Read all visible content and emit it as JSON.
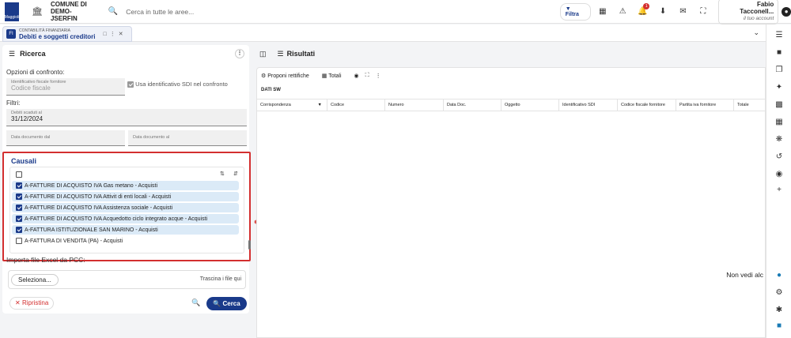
{
  "topbar": {
    "logo_text": "Maggioli",
    "comune_line1": "COMUNE DI",
    "comune_line2": "DEMO-JSERFIN",
    "search_placeholder": "Cerca in tutte le aree...",
    "filter_label": "Filtra",
    "notification_count": "1",
    "user_name": "Fabio Tacconell...",
    "user_role": "il tuo account",
    "icons": [
      "bank-icon",
      "grid-icon",
      "warning-icon",
      "bell-icon",
      "download-icon",
      "mail-icon",
      "fullscreen-icon",
      "account-icon"
    ]
  },
  "tab": {
    "subtitle": "CONTABILITÀ FINANZIARIA",
    "title": "Debiti e soggetti creditori"
  },
  "left": {
    "title": "Ricerca",
    "opzioni_label": "Opzioni di confronto:",
    "id_fiscale_label": "Identificativo fiscale fornitore",
    "id_fiscale_value": "Codice fiscale",
    "usa_sdi_label": "Usa identificativo SDI nel confronto",
    "filtri_label": "Filtri:",
    "debiti_label": "Debiti scaduti al",
    "debiti_value": "31/12/2024",
    "data_dal_label": "Data documento dal",
    "data_al_label": "Data documento al",
    "causali": {
      "title": "Causali",
      "items": [
        {
          "label": "A-FATTURE DI ACQUISTO IVA Gas metano - Acquisti",
          "checked": true
        },
        {
          "label": "A-FATTURE DI ACQUISTO IVA Attivit di enti locali - Acquisti",
          "checked": true
        },
        {
          "label": "A-FATTURE DI ACQUISTO IVA Assistenza sociale - Acquisti",
          "checked": true
        },
        {
          "label": "A-FATTURE DI ACQUISTO IVA Acquedotto ciclo integrato acque - Acquisti",
          "checked": true
        },
        {
          "label": "A-FATTURA ISTITUZIONALE SAN MARINO - Acquisti",
          "checked": true
        },
        {
          "label": "A-FATTURA DI VENDITA (PA) - Acquisti",
          "checked": false
        }
      ]
    },
    "import_label": "Importa file Excel da PCC:",
    "seleziona_label": "Seleziona...",
    "drag_label": "Trascina i file qui",
    "ripristina_label": "Ripristina",
    "cerca_label": "Cerca"
  },
  "right": {
    "title": "Risultati",
    "toolbar": {
      "proponi_label": "Proponi rettifiche",
      "totali_label": "Totali"
    },
    "group_label": "DATI SW",
    "columns": [
      "Corrispondenza",
      "Codice",
      "Numero",
      "Data Doc.",
      "Oggetto",
      "Identificativo SDI",
      "Codice fiscale fornitore",
      "Partita iva fornitore",
      "Totale"
    ],
    "empty_text": "Non vedi alc"
  },
  "colors": {
    "accent": "#1a3a8a",
    "highlight_border": "#d32f2f",
    "selected_row": "#dbeaf7"
  }
}
